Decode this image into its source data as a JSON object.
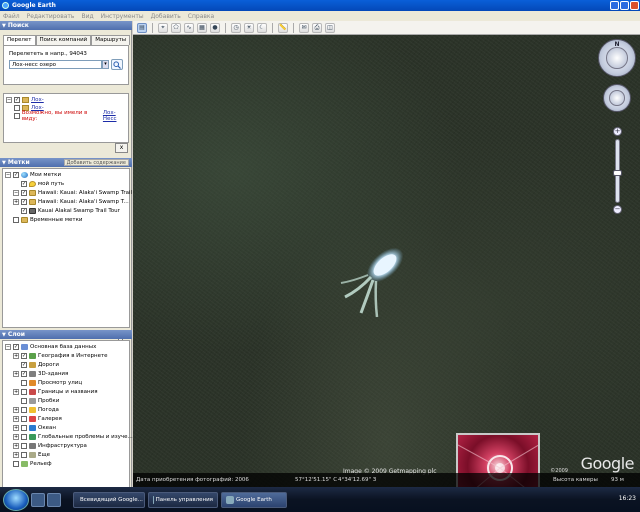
{
  "window": {
    "title": "Google Earth"
  },
  "menu": [
    "Файл",
    "Редактировать",
    "Вид",
    "Инструменты",
    "Добавить",
    "Справка"
  ],
  "search": {
    "header": "Поиск",
    "tabs": [
      "Перелет",
      "Поиск компаний",
      "Маршруты"
    ],
    "fly_label": "Перелететь в напр., 94043",
    "fly_value": "Лох-несс озеро",
    "results": [
      {
        "label": "Лох-",
        "kind": "link",
        "checked": true
      },
      {
        "label": "Лох-",
        "kind": "link",
        "checked": false
      },
      {
        "label": "Возможно, вы имели в виду:",
        "kind": "red",
        "suggestion": "Лох-Несс"
      }
    ],
    "clear": "x"
  },
  "places": {
    "header": "Метки",
    "add_content": "Добавить содержание",
    "items": [
      {
        "label": "Мои метки",
        "icon": "globe-icon",
        "level": 0,
        "expander": "−",
        "checked": true
      },
      {
        "label": "мой путь",
        "icon": "pin-icon",
        "level": 1,
        "expander": "",
        "checked": true
      },
      {
        "label": "Hawaii: Kauai: Alaka'i Swamp Trail",
        "icon": "folder-icon",
        "level": 1,
        "expander": "−",
        "checked": true
      },
      {
        "label": "Hawaii: Kauai: Alaka'i Swamp T...",
        "icon": "folder-icon",
        "level": 2,
        "expander": "+",
        "checked": true
      },
      {
        "label": "Kauai Alakai Swamp Trail Tour",
        "icon": "tour-icon",
        "level": 2,
        "expander": "",
        "checked": true
      },
      {
        "label": "Временные метки",
        "icon": "folder-icon",
        "level": 0,
        "expander": "",
        "checked": false
      }
    ]
  },
  "layers": {
    "header": "Слои",
    "items": [
      {
        "label": "Основная база данных",
        "level": 0,
        "expander": "−",
        "checked": true,
        "color": "#6a8fd6"
      },
      {
        "label": "География в Интернете",
        "level": 1,
        "expander": "+",
        "checked": true,
        "color": "#5aa04a"
      },
      {
        "label": "Дороги",
        "level": 1,
        "expander": "",
        "checked": true,
        "color": "#c8a040"
      },
      {
        "label": "3D-здания",
        "level": 1,
        "expander": "+",
        "checked": true,
        "color": "#7f7f7f"
      },
      {
        "label": "Просмотр улиц",
        "level": 1,
        "expander": "",
        "checked": false,
        "color": "#e08a2a"
      },
      {
        "label": "Границы и названия",
        "level": 1,
        "expander": "+",
        "checked": false,
        "color": "#c94a4a"
      },
      {
        "label": "Пробки",
        "level": 1,
        "expander": "",
        "checked": false,
        "color": "#9a9a9a"
      },
      {
        "label": "Погода",
        "level": 1,
        "expander": "+",
        "checked": false,
        "color": "#f0c030"
      },
      {
        "label": "Галерея",
        "level": 1,
        "expander": "+",
        "checked": false,
        "color": "#d44"
      },
      {
        "label": "Океан",
        "level": 1,
        "expander": "+",
        "checked": false,
        "color": "#2a7ad0"
      },
      {
        "label": "Глобальные проблемы и изуче...",
        "level": 1,
        "expander": "+",
        "checked": false,
        "color": "#3a9a5a"
      },
      {
        "label": "Инфраструктура",
        "level": 1,
        "expander": "+",
        "checked": false,
        "color": "#777"
      },
      {
        "label": "Еще",
        "level": 1,
        "expander": "+",
        "checked": false,
        "color": "#aa8"
      },
      {
        "label": "Рельеф",
        "level": 0,
        "expander": "",
        "checked": false,
        "color": "#8b6"
      }
    ]
  },
  "map": {
    "nav_label": "N",
    "zoom_in": "+",
    "zoom_out": "−",
    "imagery_copyright": "Image © 2009 Getmapping plc",
    "logo_copyright": "©2009",
    "logo": "Google",
    "status": {
      "imagery_date": "Дата приобретения фотографий: 2006",
      "lat": "57°12'51.15\" С",
      "lon": "4°34'12.69\" З",
      "elevation": "",
      "streaming": "Высота камеры",
      "eye_alt": "93 м"
    }
  },
  "taskbar": {
    "items": [
      "Всевидящий Google...",
      "Панель управления",
      "Google Earth"
    ],
    "active_index": 2,
    "clock": "16:23"
  }
}
